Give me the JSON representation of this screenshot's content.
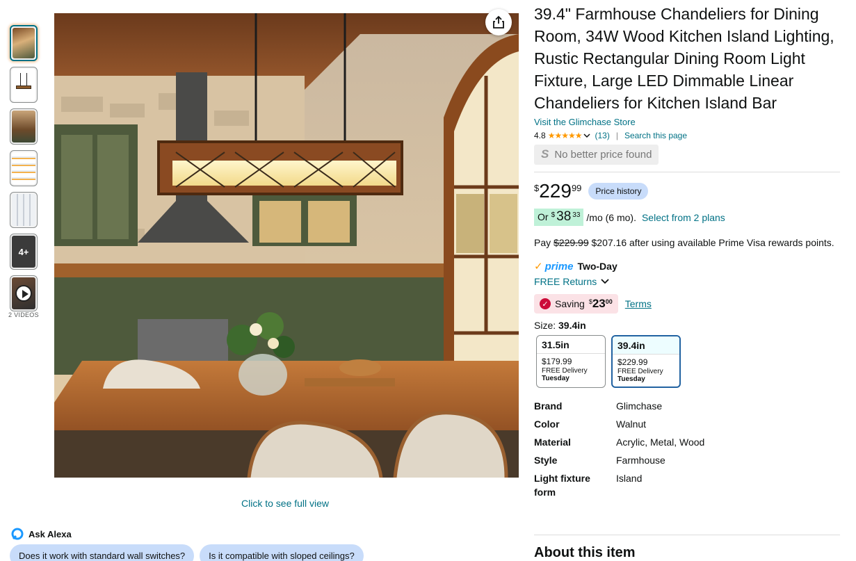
{
  "thumbnails": {
    "more_count": "4+",
    "videos_label": "2 VIDEOS"
  },
  "main_image": {
    "full_view_link": "Click to see full view"
  },
  "alexa": {
    "label": "Ask Alexa",
    "questions": [
      "Does it work with standard wall switches?",
      "Is it compatible with sloped ceilings?"
    ]
  },
  "product": {
    "title": "39.4\" Farmhouse Chandeliers for Dining Room, 34W Wood Kitchen Island Lighting, Rustic Rectangular Dining Room Light Fixture, Large LED Dimmable Linear Chandeliers for Kitchen Island Bar",
    "store_link": "Visit the Glimchase Store",
    "rating": "4.8",
    "stars": "★★★★★",
    "rating_count": "(13)",
    "search_page": "Search this page",
    "no_better_price": "No better price found",
    "price": {
      "symbol": "$",
      "whole": "229",
      "fraction": "99"
    },
    "price_history_button": "Price history",
    "monthly": {
      "prefix": "Or",
      "symbol": "$",
      "whole": "38",
      "fraction": "33",
      "suffix": "/mo (6 mo).",
      "plans_link": "Select from 2 plans"
    },
    "pay": {
      "prefix": "Pay",
      "strike": "$229.99",
      "rest": "$207.16 after using available Prime Visa rewards points."
    },
    "prime": {
      "check": "✓",
      "word": "prime",
      "delivery": "Two-Day"
    },
    "returns": "FREE Returns",
    "saving": {
      "label": "Saving",
      "symbol": "$",
      "whole": "23",
      "fraction": "00",
      "terms": "Terms"
    },
    "size": {
      "label": "Size:",
      "selected": "39.4in"
    },
    "size_options": [
      {
        "size": "31.5in",
        "price": "$179.99",
        "delivery": "FREE Delivery",
        "day": "Tuesday"
      },
      {
        "size": "39.4in",
        "price": "$229.99",
        "delivery": "FREE Delivery",
        "day": "Tuesday"
      }
    ],
    "specs": [
      {
        "key": "Brand",
        "value": "Glimchase"
      },
      {
        "key": "Color",
        "value": "Walnut"
      },
      {
        "key": "Material",
        "value": "Acrylic, Metal, Wood"
      },
      {
        "key": "Style",
        "value": "Farmhouse"
      },
      {
        "key": "Light fixture form",
        "value": "Island"
      }
    ],
    "about_heading": "About this item"
  },
  "colors": {
    "link": "#007185",
    "accent_orange": "#ff9900",
    "prime_blue": "#1a98ff",
    "saving_red": "#cc0c39",
    "selected_border": "#2162a1"
  }
}
